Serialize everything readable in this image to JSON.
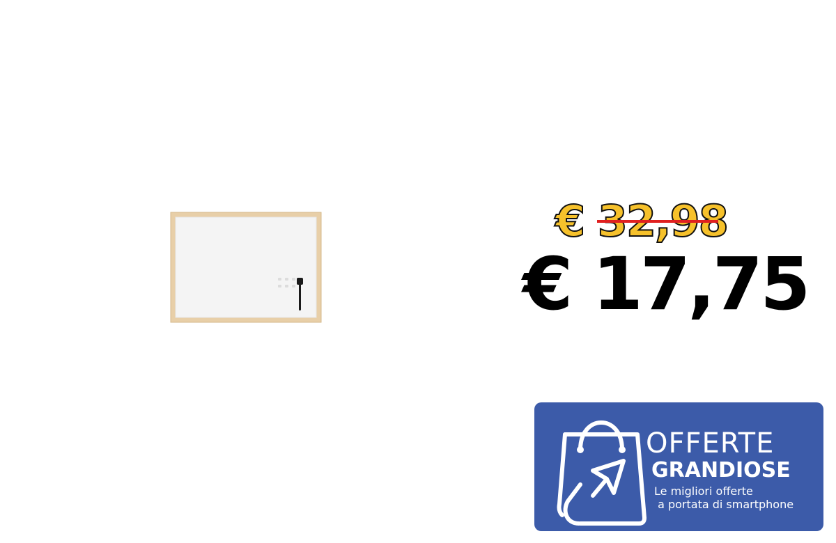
{
  "product": {
    "image_name": "whiteboard-with-wood-frame"
  },
  "pricing": {
    "old_price": "€ 32,98",
    "new_price": "€ 17,75",
    "colors": {
      "old_price_fill": "#f6c12b",
      "strike": "#e02020",
      "new_price": "#000000"
    }
  },
  "banner": {
    "line1": "OFFERTE",
    "line2": "GRANDIOSE",
    "line3": "Le migliori offerte\n a portata di smartphone",
    "icon": "shopping-bag-cursor-icon",
    "background": "#3c5ba9"
  }
}
